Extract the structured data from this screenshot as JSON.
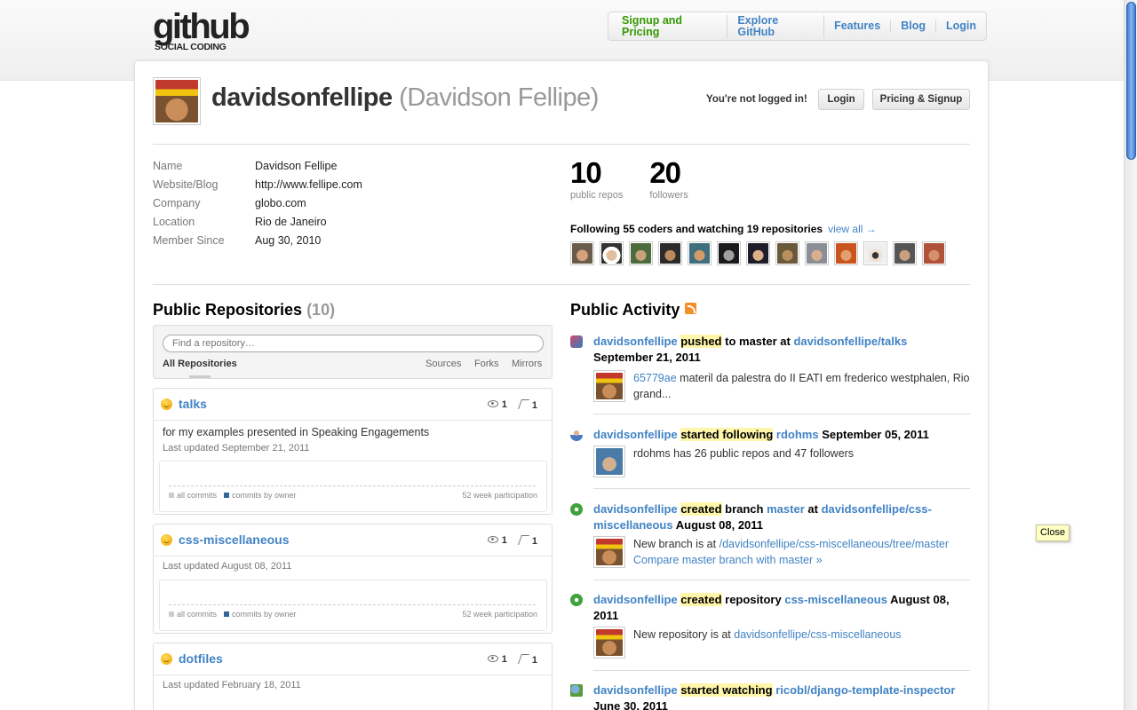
{
  "nav": {
    "logo_main": "github",
    "logo_sub": "SOCIAL CODING",
    "items": [
      "Signup and Pricing",
      "Explore GitHub",
      "Features",
      "Blog",
      "Login"
    ]
  },
  "profile": {
    "username": "davidsonfellipe",
    "fullname": "(Davidson Fellipe)",
    "not_logged": "You're not logged in!",
    "login_btn": "Login",
    "pricing_btn": "Pricing & Signup",
    "details": [
      {
        "key": "Name",
        "value": "Davidson Fellipe"
      },
      {
        "key": "Website/Blog",
        "value": "http://www.fellipe.com"
      },
      {
        "key": "Company",
        "value": "globo.com"
      },
      {
        "key": "Location",
        "value": "Rio de Janeiro"
      },
      {
        "key": "Member Since",
        "value": "Aug 30, 2010"
      }
    ],
    "stats": [
      {
        "num": "10",
        "label": "public repos"
      },
      {
        "num": "20",
        "label": "followers"
      }
    ],
    "following_text": "Following 55 coders and watching 19 repositories",
    "view_all": "view all →"
  },
  "repos": {
    "title": "Public Repositories",
    "count": "(10)",
    "search_placeholder": "Find a repository…",
    "tabs": {
      "all": "All Repositories",
      "sources": "Sources",
      "forks": "Forks",
      "mirrors": "Mirrors"
    },
    "legend": {
      "all": "all commits",
      "own": "commits by owner",
      "week": "52 week participation"
    },
    "items": [
      {
        "name": "talks",
        "watchers": "1",
        "forks": "1",
        "desc": "for my examples presented in Speaking Engagements",
        "updated": "Last updated September 21, 2011"
      },
      {
        "name": "css-miscellaneous",
        "watchers": "1",
        "forks": "1",
        "desc": "",
        "updated": "Last updated August 08, 2011"
      },
      {
        "name": "dotfiles",
        "watchers": "1",
        "forks": "1",
        "desc": "",
        "updated": "Last updated February 18, 2011"
      }
    ]
  },
  "activity": {
    "title": "Public Activity",
    "items": [
      {
        "actor": "davidsonfellipe",
        "verb": "pushed",
        "mid": "to master at",
        "target": "davidsonfellipe/talks",
        "date": "September 21, 2011",
        "sha": "65779ae",
        "body": "materil da palestra do II EATI em frederico westphalen, Rio grand..."
      },
      {
        "actor": "davidsonfellipe",
        "verb": "started following",
        "target": "rdohms",
        "date": "September 05, 2011",
        "body": "rdohms has 26 public repos and 47 followers"
      },
      {
        "actor": "davidsonfellipe",
        "verb": "created",
        "mid": "branch",
        "branch": "master",
        "at": "at",
        "target": "davidsonfellipe/css-miscellaneous",
        "date": "August 08, 2011",
        "body_prefix": "New branch is at",
        "body_link": "/davidsonfellipe/css-miscellaneous/tree/master",
        "compare": "Compare master branch with master »"
      },
      {
        "actor": "davidsonfellipe",
        "verb": "created",
        "mid": "repository",
        "target": "css-miscellaneous",
        "date": "August 08, 2011",
        "body_prefix": "New repository is at",
        "body_link": "davidsonfellipe/css-miscellaneous"
      },
      {
        "actor": "davidsonfellipe",
        "verb": "started watching",
        "target": "ricobl/django-template-inspector",
        "date": "June 30, 2011"
      }
    ]
  },
  "tooltip": "Close"
}
